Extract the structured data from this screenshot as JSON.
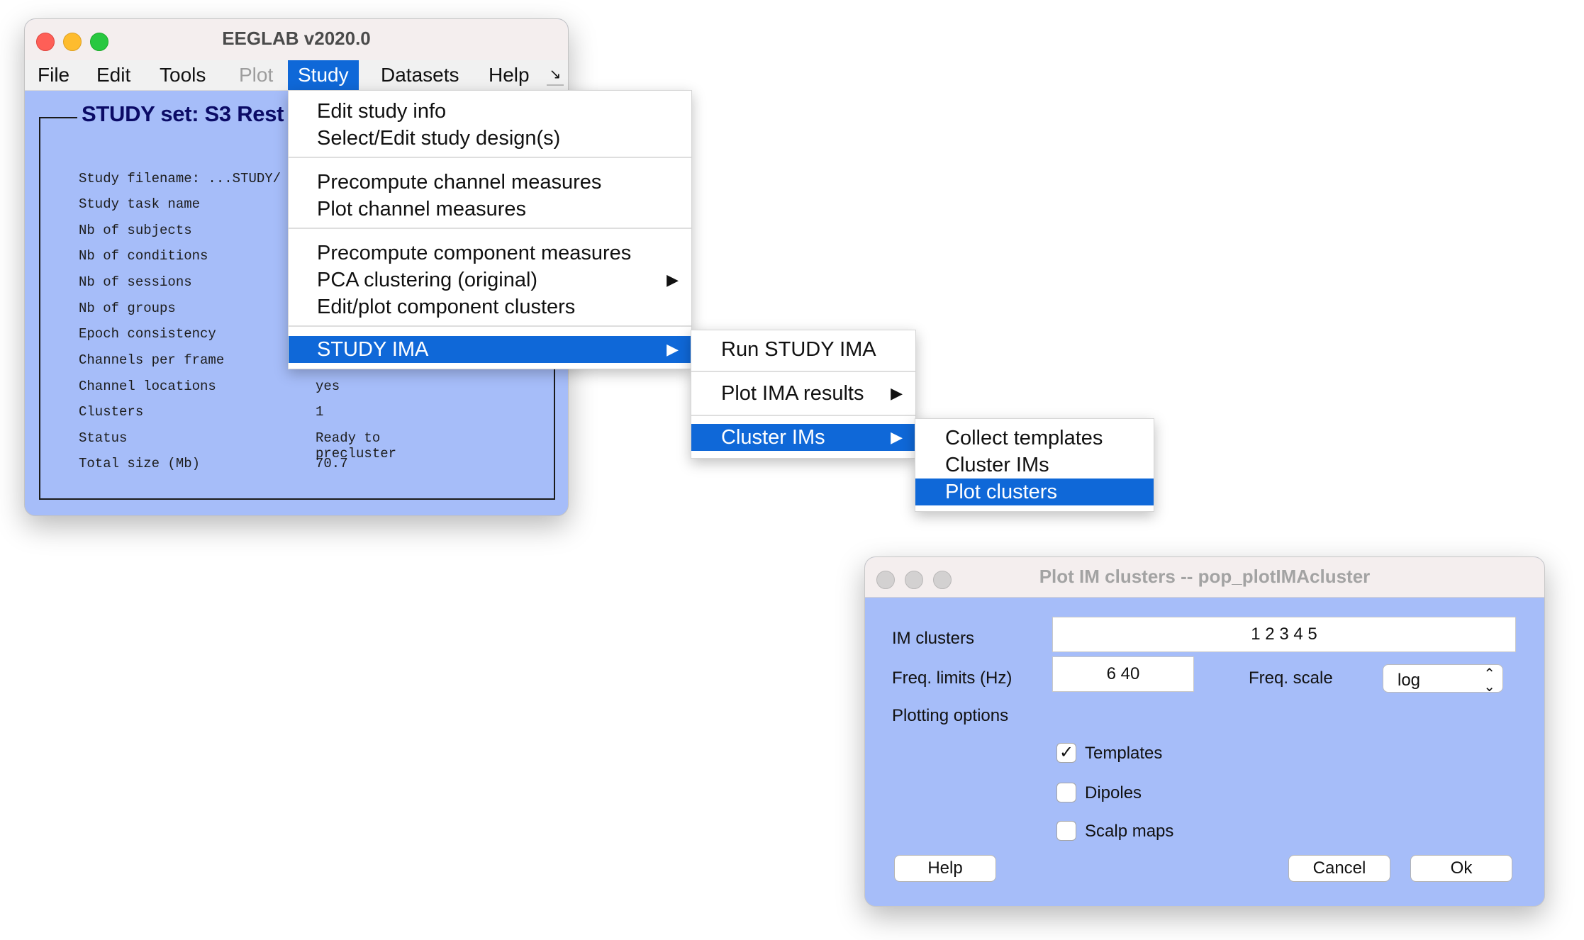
{
  "main_window": {
    "title": "EEGLAB v2020.0",
    "menu": [
      "File",
      "Edit",
      "Tools",
      "Plot",
      "Study",
      "Datasets",
      "Help"
    ],
    "more_glyph": "↘",
    "study_title": "STUDY set: S3 Rest",
    "info": [
      {
        "label": "Study filename: ...STUDY/",
        "value": ""
      },
      {
        "label": "Study task name",
        "value": ""
      },
      {
        "label": "Nb of subjects",
        "value": ""
      },
      {
        "label": "Nb of conditions",
        "value": ""
      },
      {
        "label": "Nb of sessions",
        "value": ""
      },
      {
        "label": "Nb of groups",
        "value": ""
      },
      {
        "label": "Epoch consistency",
        "value": ""
      },
      {
        "label": "Channels per frame",
        "value": ""
      },
      {
        "label": "Channel locations",
        "value": "yes"
      },
      {
        "label": "Clusters",
        "value": "1"
      },
      {
        "label": "Status",
        "value": "Ready to precluster"
      },
      {
        "label": "Total size (Mb)",
        "value": "70.7"
      }
    ]
  },
  "study_menu": {
    "items": [
      "Edit study info",
      "Select/Edit study design(s)",
      "Precompute channel measures",
      "Plot channel measures",
      "Precompute component measures",
      "PCA clustering (original)",
      "Edit/plot component clusters",
      "STUDY IMA"
    ],
    "submenu_arrow": "▶"
  },
  "ima_menu": {
    "items": [
      "Run STUDY IMA",
      "Plot IMA results",
      "Cluster IMs"
    ]
  },
  "cluster_menu": {
    "items": [
      "Collect templates",
      "Cluster IMs",
      "Plot clusters"
    ]
  },
  "dialog": {
    "title": "Plot IM clusters -- pop_plotIMAcluster",
    "im_clusters_label": "IM clusters",
    "im_clusters_value": "1 2 3 4 5",
    "freq_limits_label": "Freq. limits (Hz)",
    "freq_limits_value": "6 40",
    "freq_scale_label": "Freq. scale",
    "freq_scale_value": "log",
    "plotting_options_label": "Plotting options",
    "options": [
      {
        "label": "Templates",
        "checked": true
      },
      {
        "label": "Dipoles",
        "checked": false
      },
      {
        "label": "Scalp maps",
        "checked": false
      }
    ],
    "help_label": "Help",
    "cancel_label": "Cancel",
    "ok_label": "Ok"
  },
  "colors": {
    "window_bg": "#a6bdf9",
    "highlight": "#0f68d8",
    "title_dark_blue": "#0b0b66"
  }
}
